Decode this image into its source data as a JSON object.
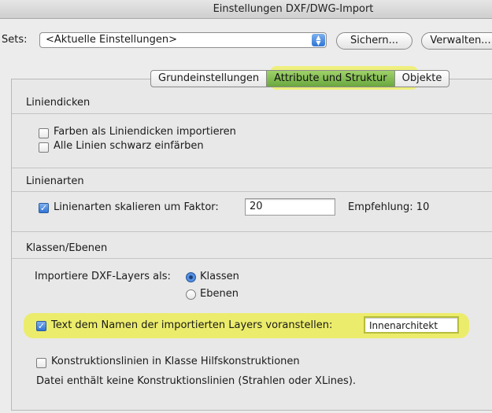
{
  "window": {
    "title": "Einstellungen DXF/DWG-Import"
  },
  "sets": {
    "label": "Sets:",
    "selected": "<Aktuelle Einstellungen>",
    "save_button": "Sichern...",
    "manage_button": "Verwalten..."
  },
  "tabs": [
    {
      "label": "Grundeinstellungen",
      "selected": false
    },
    {
      "label": "Attribute und Struktur",
      "selected": true
    },
    {
      "label": "Objekte",
      "selected": false
    }
  ],
  "line_weights": {
    "heading": "Liniendicken",
    "option1": {
      "label": "Farben als Liniendicken importieren",
      "checked": false
    },
    "option2": {
      "label": "Alle Linien schwarz einfärben",
      "checked": false
    }
  },
  "line_types": {
    "heading": "Linienarten",
    "scale": {
      "label": "Linienarten skalieren um Faktor:",
      "checked": true,
      "value": "20"
    },
    "recommendation": "Empfehlung: 10"
  },
  "classes_layers": {
    "heading": "Klassen/Ebenen",
    "import_label": "Importiere DXF-Layers als:",
    "radio_classes": {
      "label": "Klassen",
      "selected": true
    },
    "radio_layers": {
      "label": "Ebenen",
      "selected": false
    },
    "prefix": {
      "label": "Text dem Namen der importierten Layers voranstellen:",
      "checked": true,
      "value": "Innenarchitekt"
    },
    "construction": {
      "label": "Konstruktionslinien in Klasse Hilfskonstruktionen",
      "checked": false
    },
    "note": "Datei enthält keine Konstruktionslinien (Strahlen oder XLines)."
  },
  "colors": {
    "highlight": "#ecec6c",
    "accent": "#2f74d6",
    "active_tab": "#7dbb4c"
  }
}
